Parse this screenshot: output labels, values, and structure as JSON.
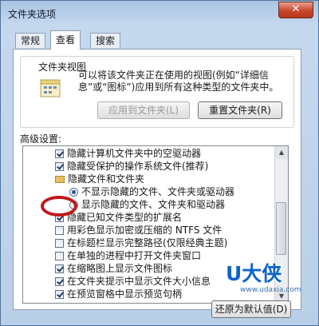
{
  "window": {
    "title": "文件夹选项",
    "close_glyph": "✕"
  },
  "tabs": [
    {
      "label": "常规",
      "active": false
    },
    {
      "label": "查看",
      "active": true
    },
    {
      "label": "搜索",
      "active": false
    }
  ],
  "folder_views": {
    "title": "文件夹视图",
    "description": "可以将该文件夹正在使用的视图(例如“详细信息”或“图标”)应用到所有这种类型的文件夹中。",
    "apply_button": "应用到文件夹(L)",
    "reset_button": "重置文件夹(R)"
  },
  "advanced": {
    "label": "高级设置:",
    "items": [
      {
        "type": "checkbox",
        "checked": true,
        "indent": 0,
        "label": "隐藏计算机文件夹中的空驱动器"
      },
      {
        "type": "checkbox",
        "checked": true,
        "indent": 0,
        "label": "隐藏受保护的操作系统文件(推荐)"
      },
      {
        "type": "folder",
        "indent": 0,
        "label": "隐藏文件和文件夹"
      },
      {
        "type": "radio",
        "checked": true,
        "indent": 1,
        "label": "不显示隐藏的文件、文件夹或驱动器"
      },
      {
        "type": "radio",
        "checked": false,
        "indent": 1,
        "label": "显示隐藏的文件、文件夹和驱动器"
      },
      {
        "type": "checkbox",
        "checked": true,
        "indent": 0,
        "label": "隐藏已知文件类型的扩展名"
      },
      {
        "type": "checkbox",
        "checked": false,
        "indent": 0,
        "label": "用彩色显示加密或压缩的 NTFS 文件"
      },
      {
        "type": "checkbox",
        "checked": false,
        "indent": 0,
        "label": "在标题栏显示完整路径(仅限经典主题)"
      },
      {
        "type": "checkbox",
        "checked": false,
        "indent": 0,
        "label": "在单独的进程中打开文件夹窗口"
      },
      {
        "type": "checkbox",
        "checked": true,
        "indent": 0,
        "label": "在缩略图上显示文件图标"
      },
      {
        "type": "checkbox",
        "checked": true,
        "indent": 0,
        "label": "在文件夹提示中显示文件大小信息"
      },
      {
        "type": "checkbox",
        "checked": true,
        "indent": 0,
        "label": "在预览窗格中显示预览句柄"
      }
    ]
  },
  "restore_button": "还原为默认值(D)",
  "watermark": {
    "brand": "U大侠",
    "url": "www.udaxia.com"
  }
}
